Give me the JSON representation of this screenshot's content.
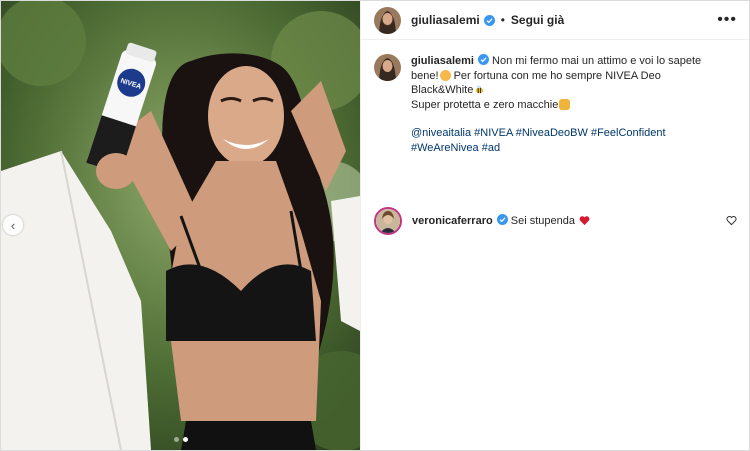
{
  "header": {
    "username": "giuliasalemi",
    "separator": "•",
    "follow_label": "Segui già",
    "more_label": "•••"
  },
  "caption": {
    "username": "giuliasalemi",
    "text_line1": "Non mi fermo mai un attimo e voi lo sapete",
    "text_line2a": "bene!",
    "text_line2b": " Per fortuna con me ho sempre NIVEA Deo",
    "text_line3a": "Black&White",
    "text_line4": "Super protetta e zero macchie",
    "hashtags": [
      "@niveaitalia",
      "#NIVEA",
      "#NiveaDeoBW",
      "#FeelConfident",
      "#WeAreNivea",
      "#ad"
    ]
  },
  "comment": {
    "username": "veronicaferraro",
    "text": "Sei stupenda"
  },
  "carousel": {
    "dot_count": 2,
    "active_index": 1,
    "prev_label": "‹"
  },
  "product_label": "NIVEA",
  "colors": {
    "verified": "#3897f0",
    "link": "#00376b",
    "heart": "#ed4956"
  }
}
